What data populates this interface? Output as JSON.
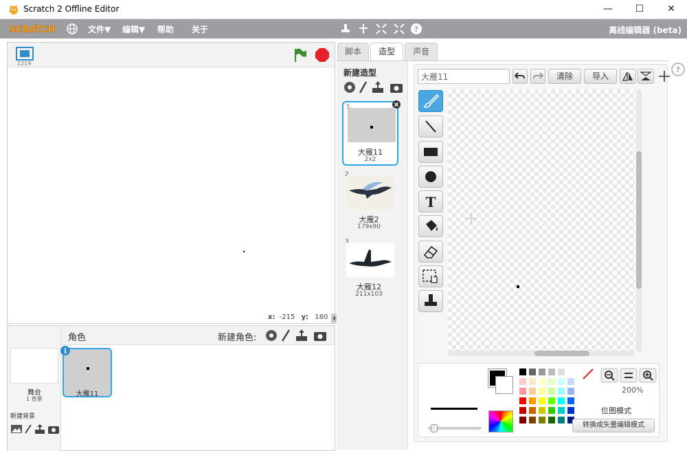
{
  "window": {
    "title": "Scratch 2 Offline Editor"
  },
  "menubar": {
    "logo": "SCRATCH",
    "items": [
      "文件▼",
      "编辑▼",
      "帮助",
      "关于"
    ],
    "right_title": "离线编辑器 (beta)"
  },
  "stage": {
    "size_label": "1219",
    "coords": {
      "x_label": "x:",
      "x_value": "-215",
      "y_label": "y:",
      "y_value": "180"
    }
  },
  "sprites": {
    "header_label": "角色",
    "new_sprite_label": "新建角色:",
    "stage_label": "舞台",
    "stage_backdrops": "1 背景",
    "new_backdrop_label": "新建背景",
    "selected_sprite": "大雁11"
  },
  "tabs": [
    "脚本",
    "造型",
    "声音"
  ],
  "costumes": {
    "new_label": "新建造型",
    "items": [
      {
        "index": "1",
        "name": "大雁11",
        "size": "2x2"
      },
      {
        "index": "2",
        "name": "大雁2",
        "size": "179x90"
      },
      {
        "index": "3",
        "name": "大雁12",
        "size": "211x103"
      }
    ]
  },
  "editor": {
    "name_value": "大雁11",
    "clear_label": "清除",
    "import_label": "导入",
    "zoom": "200%",
    "mode_label": "位图模式",
    "convert_label": "转换成矢量编辑模式",
    "help_label": "?"
  },
  "colors": {
    "accent": "#4aa6e0",
    "menubar": "#9c9ea2",
    "green_flag": "#3c8c2f",
    "stop": "#e8202a"
  }
}
